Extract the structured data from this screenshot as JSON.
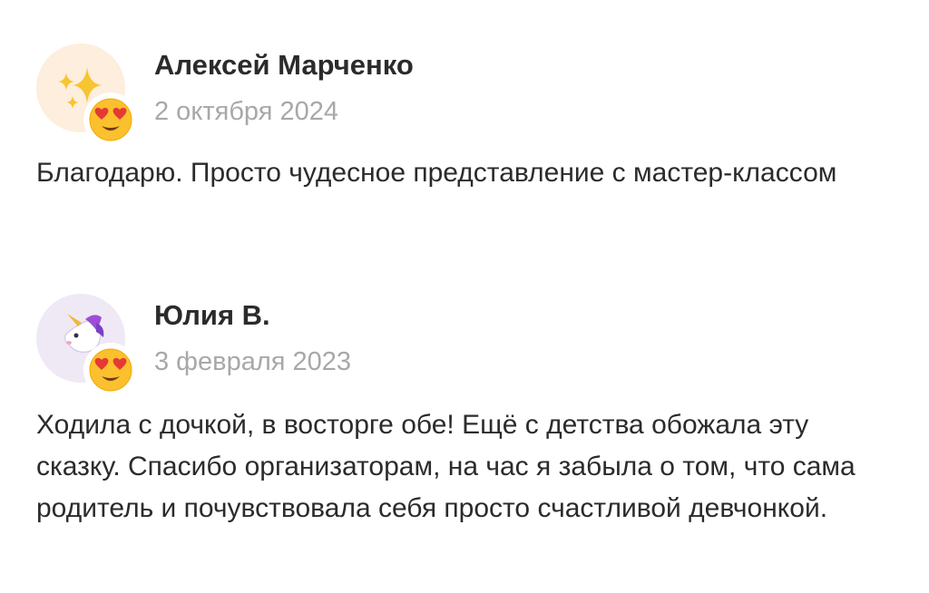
{
  "reviews": [
    {
      "author": "Алексей Марченко",
      "date": "2 октября 2024",
      "text": "Благодарю. Просто чудесное представление с мастер-классом",
      "avatar_icon": "sparkles-icon",
      "avatar_bg": "#fdeedd",
      "reaction_icon": "heart-eyes-emoji-icon"
    },
    {
      "author": "Юлия В.",
      "date": "3 февраля 2023",
      "text": "Ходила с дочкой, в восторге обе! Ещё с детства обожала эту сказку. Спасибо организаторам, на час я забыла о том, что сама родитель и почувствовала себя просто счастливой девчонкой.",
      "avatar_icon": "unicorn-icon",
      "avatar_bg": "#efe9f6",
      "reaction_icon": "heart-eyes-emoji-icon"
    }
  ],
  "colors": {
    "text": "#2b2b2b",
    "date": "#a8a8a8",
    "background": "#ffffff"
  }
}
